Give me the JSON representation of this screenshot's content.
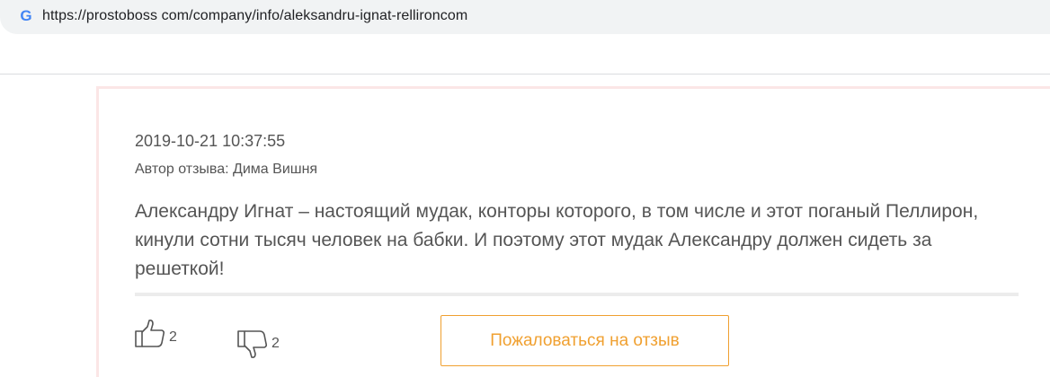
{
  "browser": {
    "url": "https://prostoboss com/company/info/aleksandru-ignat-rellironсom",
    "site_icon": "google-g-icon"
  },
  "review": {
    "date": "2019-10-21 10:37:55",
    "author": "Автор отзыва: Дима Вишня",
    "text": "Александру Игнат – настоящий мудак, конторы которого, в том числе и этот поганый Пеллирон, кинули сотни тысяч человек на бабки. И поэтому этот мудак Александру должен сидеть за решеткой!",
    "likes": "2",
    "dislikes": "2",
    "complain_label": "Пожаловаться на отзыв"
  },
  "colors": {
    "accent": "#f0a030",
    "card_border": "#fbe6e6",
    "address_bar": "#f1f3f4"
  }
}
